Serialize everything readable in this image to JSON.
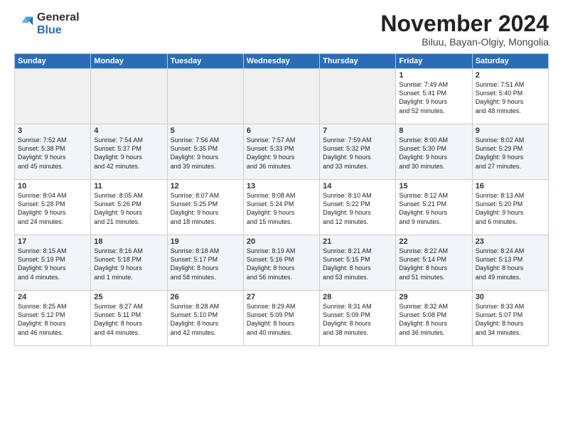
{
  "header": {
    "logo_general": "General",
    "logo_blue": "Blue",
    "title": "November 2024",
    "subtitle": "Biluu, Bayan-Olgiy, Mongolia"
  },
  "weekdays": [
    "Sunday",
    "Monday",
    "Tuesday",
    "Wednesday",
    "Thursday",
    "Friday",
    "Saturday"
  ],
  "weeks": [
    [
      {
        "day": "",
        "info": ""
      },
      {
        "day": "",
        "info": ""
      },
      {
        "day": "",
        "info": ""
      },
      {
        "day": "",
        "info": ""
      },
      {
        "day": "",
        "info": ""
      },
      {
        "day": "1",
        "info": "Sunrise: 7:49 AM\nSunset: 5:41 PM\nDaylight: 9 hours\nand 52 minutes."
      },
      {
        "day": "2",
        "info": "Sunrise: 7:51 AM\nSunset: 5:40 PM\nDaylight: 9 hours\nand 48 minutes."
      }
    ],
    [
      {
        "day": "3",
        "info": "Sunrise: 7:52 AM\nSunset: 5:38 PM\nDaylight: 9 hours\nand 45 minutes."
      },
      {
        "day": "4",
        "info": "Sunrise: 7:54 AM\nSunset: 5:37 PM\nDaylight: 9 hours\nand 42 minutes."
      },
      {
        "day": "5",
        "info": "Sunrise: 7:56 AM\nSunset: 5:35 PM\nDaylight: 9 hours\nand 39 minutes."
      },
      {
        "day": "6",
        "info": "Sunrise: 7:57 AM\nSunset: 5:33 PM\nDaylight: 9 hours\nand 36 minutes."
      },
      {
        "day": "7",
        "info": "Sunrise: 7:59 AM\nSunset: 5:32 PM\nDaylight: 9 hours\nand 33 minutes."
      },
      {
        "day": "8",
        "info": "Sunrise: 8:00 AM\nSunset: 5:30 PM\nDaylight: 9 hours\nand 30 minutes."
      },
      {
        "day": "9",
        "info": "Sunrise: 8:02 AM\nSunset: 5:29 PM\nDaylight: 9 hours\nand 27 minutes."
      }
    ],
    [
      {
        "day": "10",
        "info": "Sunrise: 8:04 AM\nSunset: 5:28 PM\nDaylight: 9 hours\nand 24 minutes."
      },
      {
        "day": "11",
        "info": "Sunrise: 8:05 AM\nSunset: 5:26 PM\nDaylight: 9 hours\nand 21 minutes."
      },
      {
        "day": "12",
        "info": "Sunrise: 8:07 AM\nSunset: 5:25 PM\nDaylight: 9 hours\nand 18 minutes."
      },
      {
        "day": "13",
        "info": "Sunrise: 8:08 AM\nSunset: 5:24 PM\nDaylight: 9 hours\nand 15 minutes."
      },
      {
        "day": "14",
        "info": "Sunrise: 8:10 AM\nSunset: 5:22 PM\nDaylight: 9 hours\nand 12 minutes."
      },
      {
        "day": "15",
        "info": "Sunrise: 8:12 AM\nSunset: 5:21 PM\nDaylight: 9 hours\nand 9 minutes."
      },
      {
        "day": "16",
        "info": "Sunrise: 8:13 AM\nSunset: 5:20 PM\nDaylight: 9 hours\nand 6 minutes."
      }
    ],
    [
      {
        "day": "17",
        "info": "Sunrise: 8:15 AM\nSunset: 5:19 PM\nDaylight: 9 hours\nand 4 minutes."
      },
      {
        "day": "18",
        "info": "Sunrise: 8:16 AM\nSunset: 5:18 PM\nDaylight: 9 hours\nand 1 minute."
      },
      {
        "day": "19",
        "info": "Sunrise: 8:18 AM\nSunset: 5:17 PM\nDaylight: 8 hours\nand 58 minutes."
      },
      {
        "day": "20",
        "info": "Sunrise: 8:19 AM\nSunset: 5:16 PM\nDaylight: 8 hours\nand 56 minutes."
      },
      {
        "day": "21",
        "info": "Sunrise: 8:21 AM\nSunset: 5:15 PM\nDaylight: 8 hours\nand 53 minutes."
      },
      {
        "day": "22",
        "info": "Sunrise: 8:22 AM\nSunset: 5:14 PM\nDaylight: 8 hours\nand 51 minutes."
      },
      {
        "day": "23",
        "info": "Sunrise: 8:24 AM\nSunset: 5:13 PM\nDaylight: 8 hours\nand 49 minutes."
      }
    ],
    [
      {
        "day": "24",
        "info": "Sunrise: 8:25 AM\nSunset: 5:12 PM\nDaylight: 8 hours\nand 46 minutes."
      },
      {
        "day": "25",
        "info": "Sunrise: 8:27 AM\nSunset: 5:11 PM\nDaylight: 8 hours\nand 44 minutes."
      },
      {
        "day": "26",
        "info": "Sunrise: 8:28 AM\nSunset: 5:10 PM\nDaylight: 8 hours\nand 42 minutes."
      },
      {
        "day": "27",
        "info": "Sunrise: 8:29 AM\nSunset: 5:09 PM\nDaylight: 8 hours\nand 40 minutes."
      },
      {
        "day": "28",
        "info": "Sunrise: 8:31 AM\nSunset: 5:09 PM\nDaylight: 8 hours\nand 38 minutes."
      },
      {
        "day": "29",
        "info": "Sunrise: 8:32 AM\nSunset: 5:08 PM\nDaylight: 8 hours\nand 36 minutes."
      },
      {
        "day": "30",
        "info": "Sunrise: 8:33 AM\nSunset: 5:07 PM\nDaylight: 8 hours\nand 34 minutes."
      }
    ]
  ]
}
